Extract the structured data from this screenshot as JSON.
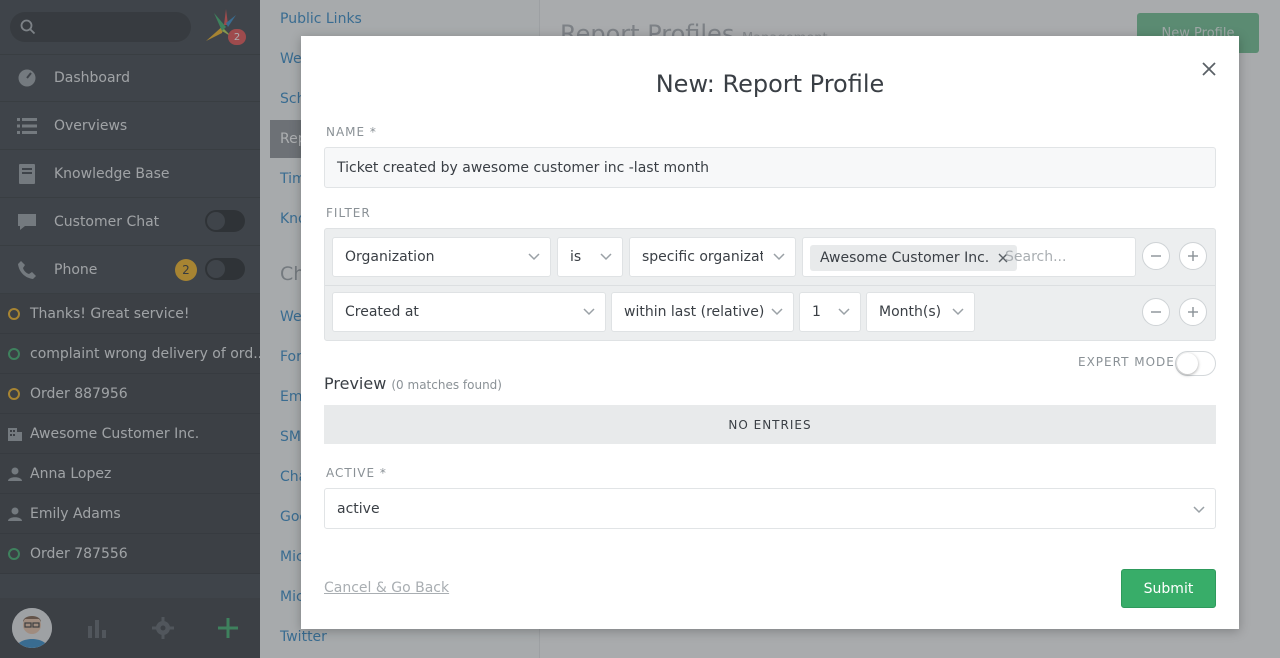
{
  "sidebar": {
    "logo_badge": "2",
    "nav": [
      {
        "label": "Dashboard",
        "icon": "dashboard-icon"
      },
      {
        "label": "Overviews",
        "icon": "overviews-icon"
      },
      {
        "label": "Knowledge Base",
        "icon": "knowledge-base-icon"
      },
      {
        "label": "Customer Chat",
        "icon": "chat-icon"
      },
      {
        "label": "Phone",
        "icon": "phone-icon",
        "badge": "2"
      }
    ],
    "tasks": [
      {
        "label": "Thanks! Great service!",
        "type": "ticket",
        "status_color": "#f6b31b"
      },
      {
        "label": "complaint wrong delivery of ord...",
        "type": "ticket",
        "status_color": "#38ad69"
      },
      {
        "label": "Order 887956",
        "type": "ticket",
        "status_color": "#f6b31b"
      },
      {
        "label": "Awesome Customer Inc.",
        "type": "organization"
      },
      {
        "label": "Anna Lopez",
        "type": "user"
      },
      {
        "label": "Emily Adams",
        "type": "user"
      },
      {
        "label": "Order 787556",
        "type": "ticket",
        "status_color": "#38ad69"
      }
    ]
  },
  "settings_nav": {
    "items": [
      "Public Links",
      "We",
      "Sch",
      "Rep",
      "Tim",
      "Kno"
    ],
    "section": "Ch",
    "items2": [
      "We",
      "For",
      "Em",
      "SM",
      "Cha",
      "Goo",
      "Mic",
      "Mic",
      "Twitter"
    ]
  },
  "background": {
    "title": "Report Profiles",
    "subtitle": "Management",
    "new_button": "New Profile"
  },
  "modal": {
    "title": "New: Report Profile",
    "name_label": "Name *",
    "name_value": "Ticket created by awesome customer inc -last month",
    "filter_label": "Filter",
    "row1": {
      "attribute": "Organization",
      "operator": "is",
      "mode": "specific organization",
      "tag": "Awesome Customer Inc.",
      "search_placeholder": "Search..."
    },
    "row2": {
      "attribute": "Created at",
      "operator": "within last (relative)",
      "value": "1",
      "unit": "Month(s)"
    },
    "expert_mode_label": "EXPERT MODE",
    "preview_label": "Preview",
    "preview_count": "(0 matches found)",
    "no_entries": "NO ENTRIES",
    "active_label": "Active *",
    "active_value": "active",
    "cancel_label": "Cancel & Go Back",
    "submit_label": "Submit"
  }
}
